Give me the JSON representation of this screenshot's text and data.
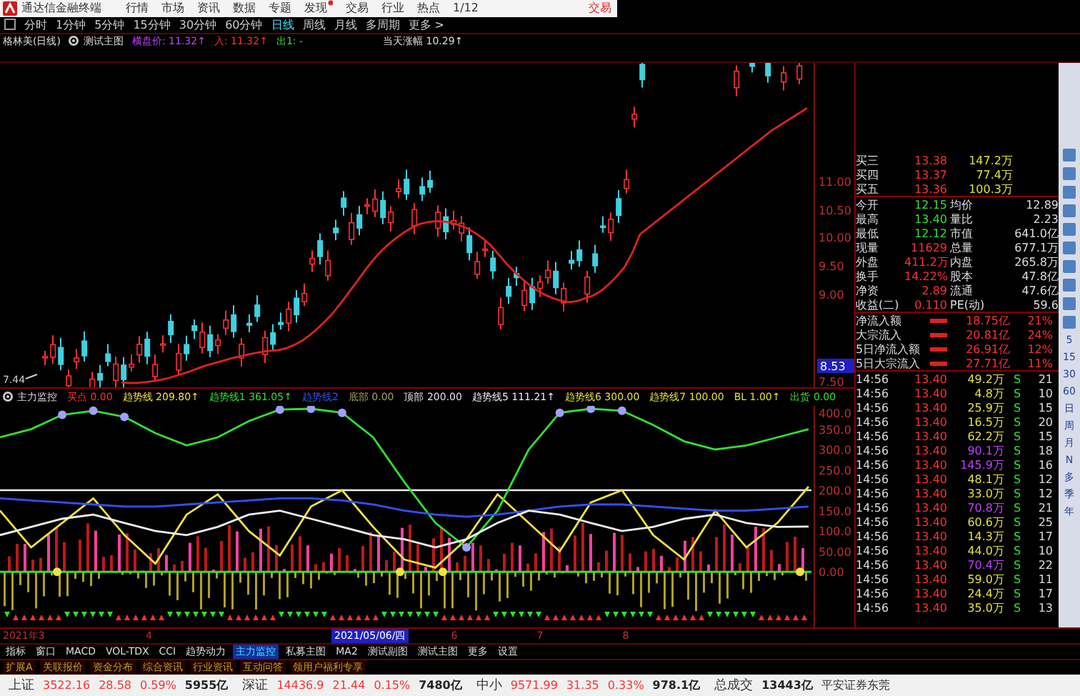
{
  "menu_bar": {
    "app_title": "通达信金融终端",
    "items": [
      {
        "label": "行情",
        "dot": false
      },
      {
        "label": "市场",
        "dot": false
      },
      {
        "label": "资讯",
        "dot": false
      },
      {
        "label": "数据",
        "dot": false
      },
      {
        "label": "专题",
        "dot": false
      },
      {
        "label": "发现",
        "dot": true
      },
      {
        "label": "交易",
        "dot": false
      },
      {
        "label": "行业",
        "dot": false
      },
      {
        "label": "热点",
        "dot": false
      },
      {
        "label": "1/12",
        "dot": false
      }
    ],
    "trade_label": "交易"
  },
  "periods": [
    {
      "label": "分时",
      "selected": false
    },
    {
      "label": "1分钟",
      "selected": false
    },
    {
      "label": "5分钟",
      "selected": false
    },
    {
      "label": "15分钟",
      "selected": false
    },
    {
      "label": "30分钟",
      "selected": false
    },
    {
      "label": "60分钟",
      "selected": false
    },
    {
      "label": "日线",
      "selected": true
    },
    {
      "label": "周线",
      "selected": false
    },
    {
      "label": "月线",
      "selected": false
    },
    {
      "label": "多周期",
      "selected": false
    },
    {
      "label": "更多 >",
      "selected": false
    }
  ],
  "title_row": {
    "stock": "格林美(日线)",
    "main_chart": "测试主图",
    "fields": [
      {
        "label": "横盘价: 11.32↑",
        "color": "#c040ff"
      },
      {
        "label": "入: 11.32↑",
        "color": "#ff3030"
      },
      {
        "label": "出1: -",
        "color": "#30e030"
      }
    ],
    "change": "当天涨幅 10.29↑"
  },
  "price_chart": {
    "axis_labels": [
      "11.00",
      "10.50",
      "10.00",
      "9.50",
      "9.00",
      "7.50"
    ],
    "current_price": "8.53",
    "low_label": "7.44"
  },
  "indicator": {
    "name": "主力监控",
    "lines": [
      {
        "name": "买点",
        "value": "0.00",
        "color": "#ff3030"
      },
      {
        "kind": "series",
        "value": "209.80↑"
      },
      {
        "kind": "series",
        "value": "361.05↑"
      },
      {
        "kind": "series"
      },
      {
        "name": "底部",
        "value": "0.00",
        "color": "#a0a060"
      },
      {
        "name": "顶部",
        "value": "200.00",
        "color": "#e0e0e0"
      },
      {
        "kind": "series",
        "value": "111.21↑"
      },
      {
        "name": "趋势线6",
        "value": "300.00",
        "color": "#e0e040"
      },
      {
        "name": "趋势线7",
        "value": "100.00",
        "color": "#e0e040"
      },
      {
        "name": "BL",
        "value": "1.00↑",
        "color": "#e0e040"
      },
      {
        "name": "出货",
        "value": "0.00",
        "color": "#30e030"
      }
    ],
    "chart_data": {
      "type": "line",
      "ylim": [
        -140,
        407
      ],
      "yticks": [
        {
          "value": 400,
          "label": "400.0"
        },
        {
          "value": 350,
          "label": "350.0"
        },
        {
          "value": 300,
          "label": "300.0"
        },
        {
          "value": 250,
          "label": "250.0"
        },
        {
          "value": 200,
          "label": "200.0"
        },
        {
          "value": 150,
          "label": "150.0"
        },
        {
          "value": 100,
          "label": "100.0"
        },
        {
          "value": 50,
          "label": "50.00"
        },
        {
          "value": 0,
          "label": "0.00"
        }
      ],
      "series": [
        {
          "name": "趋势线",
          "color": "#f0e040",
          "values": [
            150,
            60,
            120,
            180,
            90,
            20,
            140,
            190,
            100,
            40,
            160,
            200,
            110,
            30,
            10,
            80,
            190,
            120,
            50,
            170,
            200,
            90,
            30,
            150,
            60,
            120,
            209
          ]
        },
        {
          "name": "趋势线1",
          "color": "#30e030",
          "values": [
            330,
            350,
            385,
            395,
            380,
            340,
            310,
            330,
            370,
            398,
            400,
            390,
            330,
            220,
            120,
            60,
            150,
            300,
            390,
            400,
            395,
            360,
            320,
            300,
            310,
            330,
            350
          ]
        },
        {
          "name": "趋势线2",
          "color": "#3050ff",
          "values": [
            180,
            175,
            170,
            165,
            160,
            160,
            165,
            170,
            175,
            180,
            180,
            175,
            165,
            150,
            140,
            135,
            140,
            150,
            160,
            165,
            165,
            160,
            155,
            150,
            150,
            155,
            160
          ]
        },
        {
          "name": "趋势线5",
          "color": "#eeeeee",
          "values": [
            90,
            110,
            130,
            140,
            120,
            100,
            90,
            110,
            140,
            150,
            130,
            110,
            90,
            80,
            60,
            80,
            120,
            150,
            140,
            120,
            100,
            110,
            130,
            140,
            120,
            110,
            111
          ]
        }
      ]
    }
  },
  "quote_panel": {
    "order_book": [
      {
        "label": "买三",
        "price": "13.38",
        "volume": "147.2万"
      },
      {
        "label": "买四",
        "price": "13.37",
        "volume": "77.4万"
      },
      {
        "label": "买五",
        "price": "13.36",
        "volume": "100.3万"
      }
    ],
    "stats": [
      {
        "label": "今开",
        "value": "12.15",
        "label2": "均价",
        "value2": "12.89"
      },
      {
        "label": "最高",
        "value": "13.40",
        "label2": "量比",
        "value2": "2.23"
      },
      {
        "label": "最低",
        "value": "12.12",
        "label2": "市值",
        "value2": "641.0亿"
      },
      {
        "label": "现量",
        "value": "11629",
        "label2": "总量",
        "value2": "677.1万"
      },
      {
        "label": "外盘",
        "value": "411.2万",
        "label2": "内盘",
        "value2": "265.8万"
      },
      {
        "label": "换手",
        "value": "14.22%",
        "label2": "股本",
        "value2": "47.8亿"
      },
      {
        "label": "净资",
        "value": "2.89",
        "label2": "流通",
        "value2": "47.6亿"
      },
      {
        "label": "收益(二)",
        "value": "0.110",
        "label2": "PE(动)",
        "value2": "59.6"
      }
    ],
    "flows": [
      {
        "label": "净流入额",
        "value": "18.75亿",
        "pct": "21%"
      },
      {
        "label": "大宗流入",
        "value": "20.81亿",
        "pct": "24%"
      },
      {
        "label": "5日净流入额",
        "value": "26.91亿",
        "pct": "12%"
      },
      {
        "label": "5日大宗流入",
        "value": "27.71亿",
        "pct": "11%"
      }
    ],
    "ticks": [
      {
        "time": "14:56",
        "price": "13.40",
        "volume": "49.2万",
        "side": "S",
        "count": "21",
        "color": "#e0e040"
      },
      {
        "time": "14:56",
        "price": "13.40",
        "volume": "4.8万",
        "side": "S",
        "count": "10",
        "color": "#e0e040"
      },
      {
        "time": "14:56",
        "price": "13.40",
        "volume": "25.9万",
        "side": "S",
        "count": "15",
        "color": "#e0e040"
      },
      {
        "time": "14:56",
        "price": "13.40",
        "volume": "16.5万",
        "side": "S",
        "count": "20",
        "color": "#e0e040"
      },
      {
        "time": "14:56",
        "price": "13.40",
        "volume": "62.2万",
        "side": "S",
        "count": "15",
        "color": "#e0e040"
      },
      {
        "time": "14:56",
        "price": "13.40",
        "volume": "90.1万",
        "side": "S",
        "count": "18",
        "color": "#c040ff"
      },
      {
        "time": "14:56",
        "price": "13.40",
        "volume": "145.9万",
        "side": "S",
        "count": "16",
        "color": "#c040ff"
      },
      {
        "time": "14:56",
        "price": "13.40",
        "volume": "48.1万",
        "side": "S",
        "count": "12",
        "color": "#e0e040"
      },
      {
        "time": "14:56",
        "price": "13.40",
        "volume": "33.0万",
        "side": "S",
        "count": "12",
        "color": "#e0e040"
      },
      {
        "time": "14:56",
        "price": "13.40",
        "volume": "70.8万",
        "side": "S",
        "count": "21",
        "color": "#c040ff"
      },
      {
        "time": "14:56",
        "price": "13.40",
        "volume": "60.6万",
        "side": "S",
        "count": "25",
        "color": "#e0e040"
      },
      {
        "time": "14:56",
        "price": "13.40",
        "volume": "14.3万",
        "side": "S",
        "count": "17",
        "color": "#e0e040"
      },
      {
        "time": "14:56",
        "price": "13.40",
        "volume": "44.0万",
        "side": "S",
        "count": "10",
        "color": "#e0e040"
      },
      {
        "time": "14:56",
        "price": "13.40",
        "volume": "70.4万",
        "side": "S",
        "count": "22",
        "color": "#c040ff"
      },
      {
        "time": "14:56",
        "price": "13.40",
        "volume": "59.0万",
        "side": "S",
        "count": "11",
        "color": "#e0e040"
      },
      {
        "time": "14:56",
        "price": "13.40",
        "volume": "24.4万",
        "side": "S",
        "count": "17",
        "color": "#e0e040"
      },
      {
        "time": "14:56",
        "price": "13.40",
        "volume": "35.0万",
        "side": "S",
        "count": "13",
        "color": "#e0e040"
      }
    ]
  },
  "side_periods": [
    "5",
    "15",
    "30",
    "60",
    "日",
    "周",
    "月",
    "N",
    "多",
    "季",
    "年"
  ],
  "date_axis": {
    "start": "2021年3",
    "marks": [
      "4",
      "6",
      "7",
      "8"
    ],
    "cursor_date": "2021/05/06/四"
  },
  "tabs": [
    {
      "label": "指标",
      "selected": false
    },
    {
      "label": "窗口",
      "selected": false
    },
    {
      "label": "MACD",
      "selected": false
    },
    {
      "label": "VOL-TDX",
      "selected": false
    },
    {
      "label": "CCI",
      "selected": false
    },
    {
      "label": "趋势动力",
      "selected": false
    },
    {
      "label": "主力监控",
      "selected": true
    },
    {
      "label": "私募主图",
      "selected": false
    },
    {
      "label": "MA2",
      "selected": false
    },
    {
      "label": "测试副图",
      "selected": false
    },
    {
      "label": "测试主图",
      "selected": false
    },
    {
      "label": "更多",
      "selected": false
    },
    {
      "label": "设置",
      "selected": false
    }
  ],
  "ext_tabs": [
    "扩展A",
    "关联报价",
    "资金分布",
    "综合资讯",
    "行业资讯",
    "互动问答",
    "领用户福利专享"
  ],
  "status_bar": {
    "indices": [
      {
        "name": "上证",
        "value": "3522.16",
        "change": "28.58",
        "pct": "0.59%",
        "amount": "5955亿"
      },
      {
        "name": "深证",
        "value": "14436.9",
        "change": "21.44",
        "pct": "0.15%",
        "amount": "7480亿"
      },
      {
        "name": "中小",
        "value": "9571.99",
        "change": "31.35",
        "pct": "0.33%",
        "amount": "978.1亿"
      }
    ],
    "total_label": "总成交",
    "total_value": "13443亿",
    "broker": "平安证券东莞"
  }
}
